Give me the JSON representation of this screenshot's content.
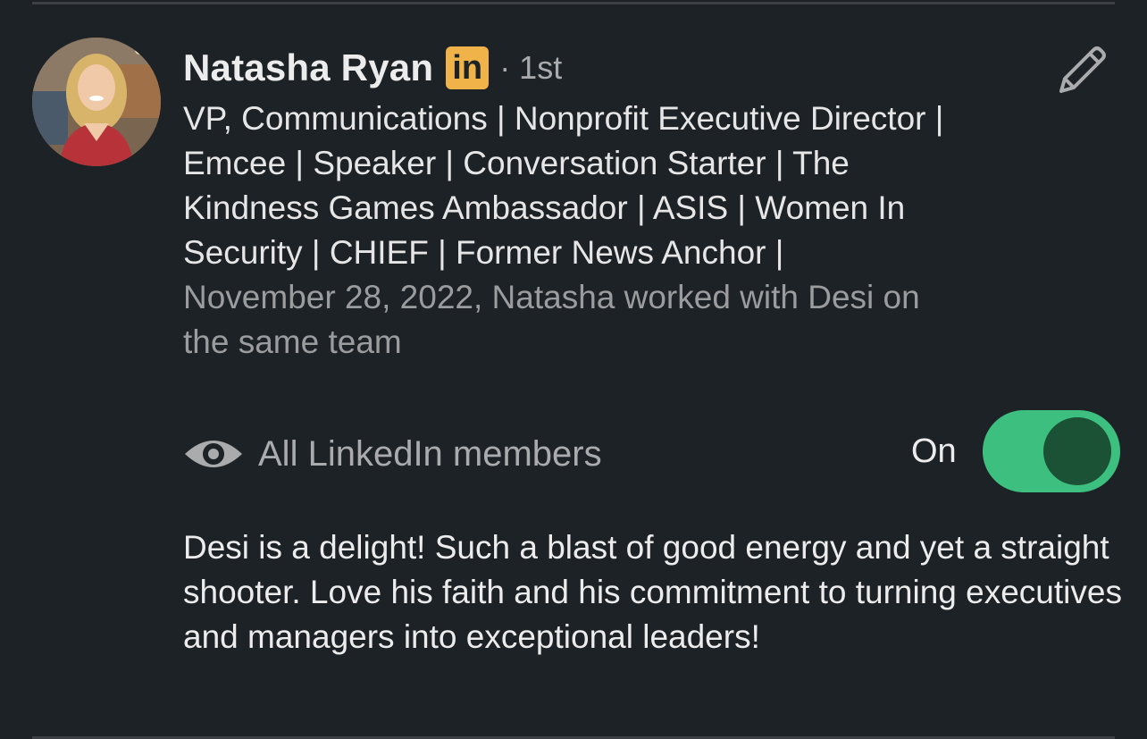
{
  "recommender": {
    "name": "Natasha Ryan",
    "badge": "in",
    "degree": "· 1st",
    "headline": "VP, Communications | Nonprofit Executive Director | Emcee | Speaker | Conversation Starter | The Kindness Games Ambassador | ASIS | Women In Security | CHIEF | Former News Anchor |",
    "relationship": "November 28, 2022, Natasha worked with Desi on the same team"
  },
  "visibility": {
    "icon": "eye-icon",
    "label": "All LinkedIn members",
    "toggle_label": "On",
    "toggle_on": true
  },
  "recommendation": {
    "text": "Desi is a delight! Such a blast of good energy and yet a straight shooter. Love his faith and his commitment to turning executives and managers into exceptional leaders!"
  },
  "colors": {
    "background": "#1d2226",
    "toggle_on": "#3cbf7f",
    "linkedin_badge": "#f0b34a"
  },
  "icons": {
    "edit": "pencil-icon"
  }
}
